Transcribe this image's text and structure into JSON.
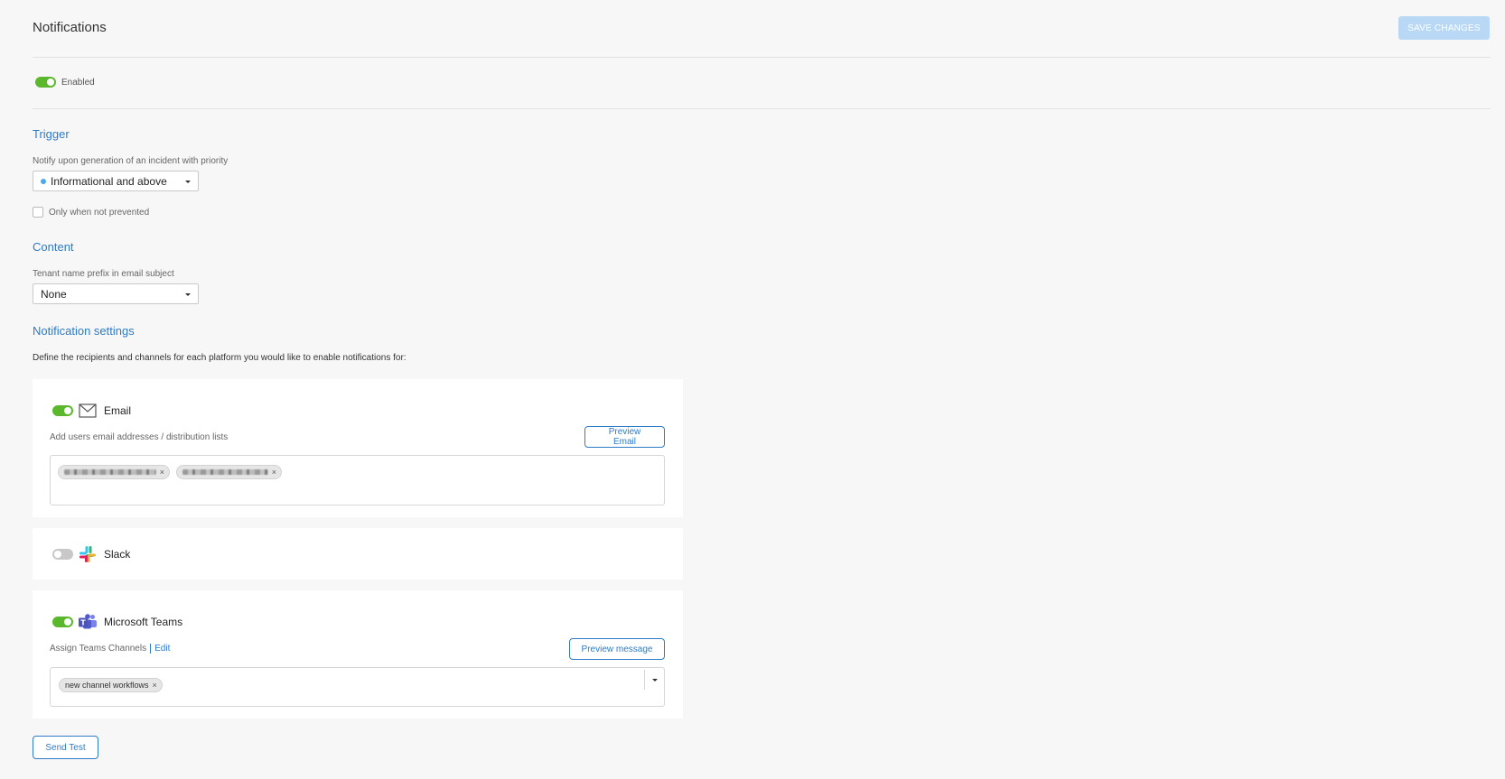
{
  "header": {
    "title": "Notifications",
    "save_label": "SAVE CHANGES"
  },
  "enabled": {
    "label": "Enabled",
    "on": true
  },
  "trigger": {
    "title": "Trigger",
    "priority_label": "Notify upon generation of an incident with priority",
    "priority_value": "Informational and above",
    "priority_dot_color": "#4aa9ea",
    "checkbox_label": "Only when not prevented",
    "checkbox_checked": false
  },
  "content": {
    "title": "Content",
    "prefix_label": "Tenant name prefix in email subject",
    "prefix_value": "None"
  },
  "notification_settings": {
    "title": "Notification settings",
    "description": "Define the recipients and channels for each platform you would like to enable notifications for:"
  },
  "email": {
    "title": "Email",
    "enabled": true,
    "subtitle": "Add users email addresses / distribution lists",
    "preview_label": "Preview Email",
    "chip_remove": "×"
  },
  "slack": {
    "title": "Slack",
    "enabled": false
  },
  "teams": {
    "title": "Microsoft Teams",
    "enabled": true,
    "assign_label": "Assign Teams Channels",
    "edit_label": "Edit",
    "preview_label": "Preview message",
    "channels": [
      "new channel workflows"
    ],
    "chip_remove": "×"
  },
  "footer": {
    "send_test_label": "Send Test"
  },
  "colors": {
    "accent": "#2e7bc6",
    "toggle_on": "#5bb82d",
    "save_disabled": "#b9d8f5"
  }
}
